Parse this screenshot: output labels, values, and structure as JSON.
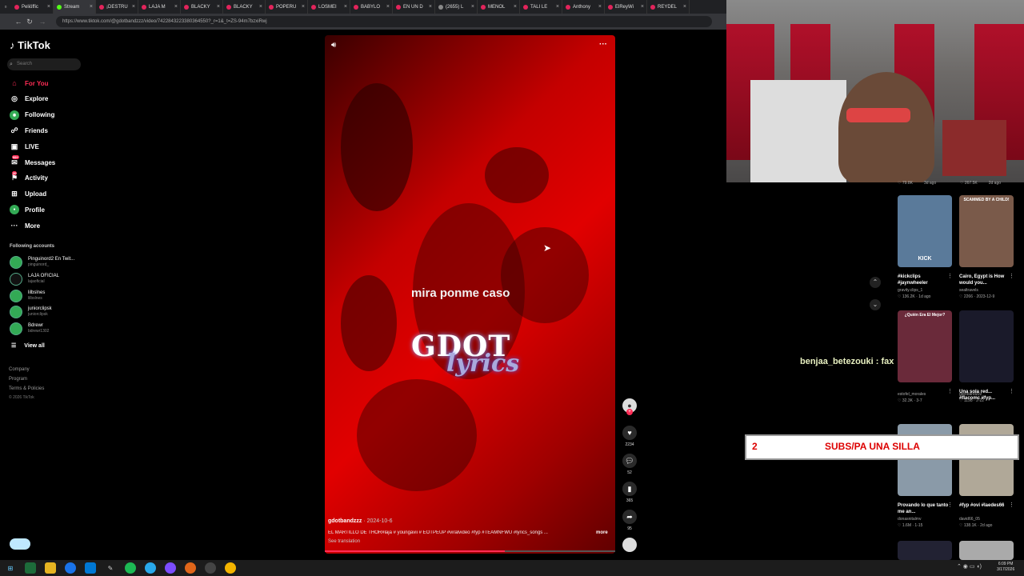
{
  "browser": {
    "tabs": [
      "Peliöffic",
      "Stream",
      "¡DESTRU",
      "LAJA M",
      "BLACKY",
      "BLACKY",
      "POPERU",
      "LOSMEI",
      "BABYLO",
      "EN UN D",
      "(2655) L",
      "MENOL",
      "TALI LE",
      "Anthony",
      "ElReyWi",
      "REYDEL"
    ],
    "url": "https://www.tiktok.com/@gdotbandzzz/video/7422843223380364550?_r=1&_t=ZS-94m7bzxiRwj"
  },
  "sidebar": {
    "logo": "TikTok",
    "search_placeholder": "Search",
    "nav": [
      {
        "label": "For You",
        "icon": "home-icon"
      },
      {
        "label": "Explore",
        "icon": "compass-icon"
      },
      {
        "label": "Following",
        "icon": "following-icon"
      },
      {
        "label": "Friends",
        "icon": "friends-icon"
      },
      {
        "label": "LIVE",
        "icon": "live-icon"
      },
      {
        "label": "Messages",
        "icon": "messages-icon",
        "badge": "99+"
      },
      {
        "label": "Activity",
        "icon": "activity-icon",
        "badge": "20"
      },
      {
        "label": "Upload",
        "icon": "upload-icon"
      },
      {
        "label": "Profile",
        "icon": "profile-icon"
      },
      {
        "label": "More",
        "icon": "more-icon"
      }
    ],
    "following_title": "Following accounts",
    "accounts": [
      {
        "name": "Pinguinord2 En Twit...",
        "handle": "pinguinord_"
      },
      {
        "name": "LAJA OFICIAL",
        "handle": "lajaoficial"
      },
      {
        "name": "lilbslnes",
        "handle": "lilbslnes"
      },
      {
        "name": "juniorclipsk",
        "handle": "juniorclipsk"
      },
      {
        "name": "Bdrewr",
        "handle": "bdrewr1302"
      }
    ],
    "view_all": "View all",
    "footer": [
      "Company",
      "Program",
      "Terms & Policies",
      "© 2026 TikTok"
    ]
  },
  "video": {
    "caption_overlay": "mira ponme caso",
    "logo_top": "GDOT",
    "logo_bottom": "lyrics",
    "author": "gdotbandzzz",
    "date": "· 2024-10-6",
    "description": "EL MARTILLO DE THOR#laja # youngavii # EOTPEUP #viralvideo #fyp #TEAMNFWU #lyrics_songs ...",
    "more": "more",
    "see_translation": "See translation",
    "progress": 0.62,
    "likes": "2234",
    "comments": "52",
    "saves": "365",
    "shares": "95"
  },
  "right_panel": {
    "top_stats": [
      {
        "views": "79.8K",
        "time": "3d ago"
      },
      {
        "views": "267.5K",
        "time": "2d ago"
      }
    ],
    "items": [
      {
        "title": "#kickclips #jaynwheeler",
        "author": "gravity.clips_1",
        "stats": "♡ 136.2K · 1d ago",
        "thumb_text": "KICK"
      },
      {
        "title": "Cairo, Egypt is How would you...",
        "author": "sealtravels",
        "stats": "♡ 2266 · 2023-12-9",
        "thumb_text": "SCAMMED BY A CHILD!"
      },
      {
        "title": "",
        "author": "estofel_morales",
        "stats": "♡ 32.3K · 3-7",
        "thumb_text": "¿Quién Era El Mejor?"
      },
      {
        "title": "Una sola red... #flacomc #fyp...",
        "author": "gdotbandzzz",
        "stats": "♡ 1198 · 2-22",
        "thumb_text": ""
      },
      {
        "title": "Provando lo que tanto me an...",
        "author": "donasnitalmv",
        "stats": "♡ 1.6M · 1-15",
        "thumb_text": ""
      },
      {
        "title": "#fyp #ovi #laedes66",
        "author": "david66_05",
        "stats": "♡ 138.1K · 2d ago",
        "thumb_text": ""
      }
    ]
  },
  "stream_overlay": {
    "chat_message": "benjaa_betezouki : fax",
    "subs_count": "2",
    "subs_text": "SUBS/PA UNA SILLA"
  },
  "taskbar": {
    "time": "6:09 PM",
    "date": "3/17/2026"
  },
  "colors": {
    "tiktok_red": "#fe2c55",
    "video_red": "#e10000"
  }
}
